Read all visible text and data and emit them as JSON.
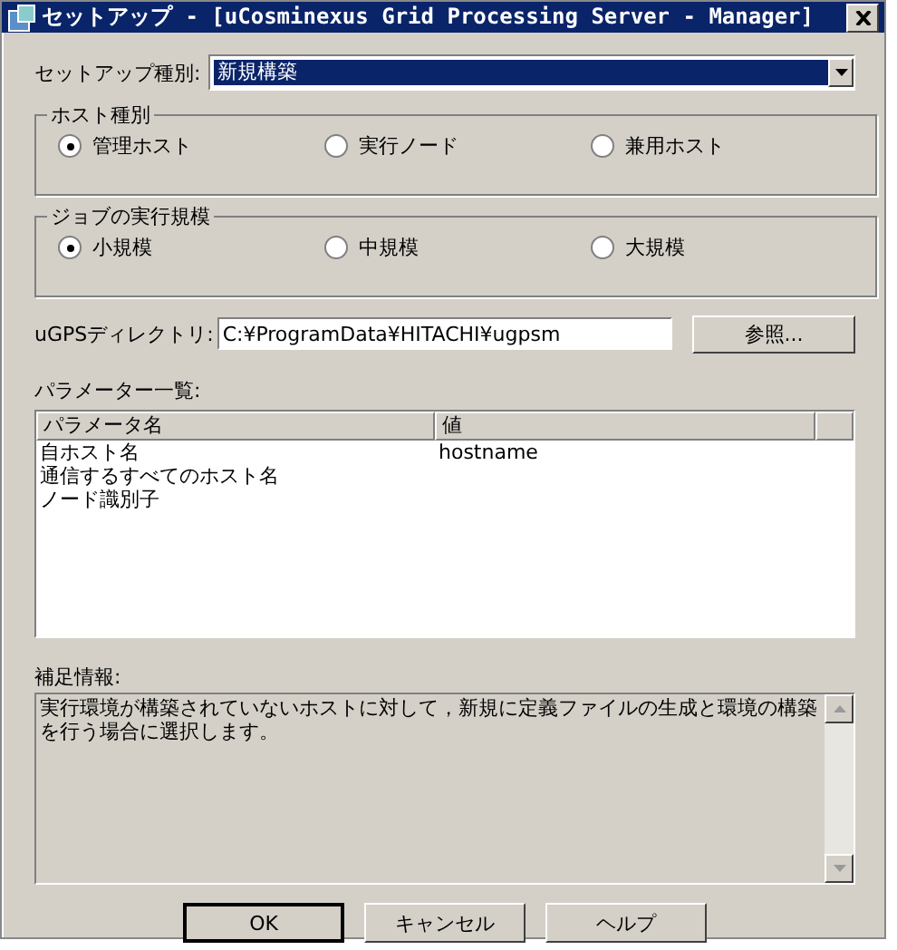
{
  "window": {
    "title": "セットアップ - [uCosminexus Grid Processing Server - Manager]"
  },
  "setup_type": {
    "label": "セットアップ種別:",
    "value": "新規構築"
  },
  "groups": [
    {
      "title": "ホスト種別",
      "options": [
        {
          "label": "管理ホスト",
          "selected": true
        },
        {
          "label": "実行ノード",
          "selected": false
        },
        {
          "label": "兼用ホスト",
          "selected": false
        }
      ]
    },
    {
      "title": "ジョブの実行規模",
      "options": [
        {
          "label": "小規模",
          "selected": true
        },
        {
          "label": "中規模",
          "selected": false
        },
        {
          "label": "大規模",
          "selected": false
        }
      ]
    }
  ],
  "directory": {
    "label": "uGPSディレクトリ:",
    "value": "C:¥ProgramData¥HITACHI¥ugpsm",
    "button": "参照..."
  },
  "parameters": {
    "label": "パラメーター一覧:",
    "columns": [
      "パラメータ名",
      "値"
    ],
    "rows": [
      {
        "name": "自ホスト名",
        "value": "hostname"
      },
      {
        "name": "通信するすべてのホスト名",
        "value": ""
      },
      {
        "name": "ノード識別子",
        "value": ""
      }
    ]
  },
  "info": {
    "label": "補足情報:",
    "text": "実行環境が構築されていないホストに対して，新規に定義ファイルの生成と環境の構築を行う場合に選択します。"
  },
  "buttons": [
    {
      "label": "OK",
      "default": true
    },
    {
      "label": "キャンセル",
      "default": false
    },
    {
      "label": "ヘルプ",
      "default": false
    }
  ]
}
